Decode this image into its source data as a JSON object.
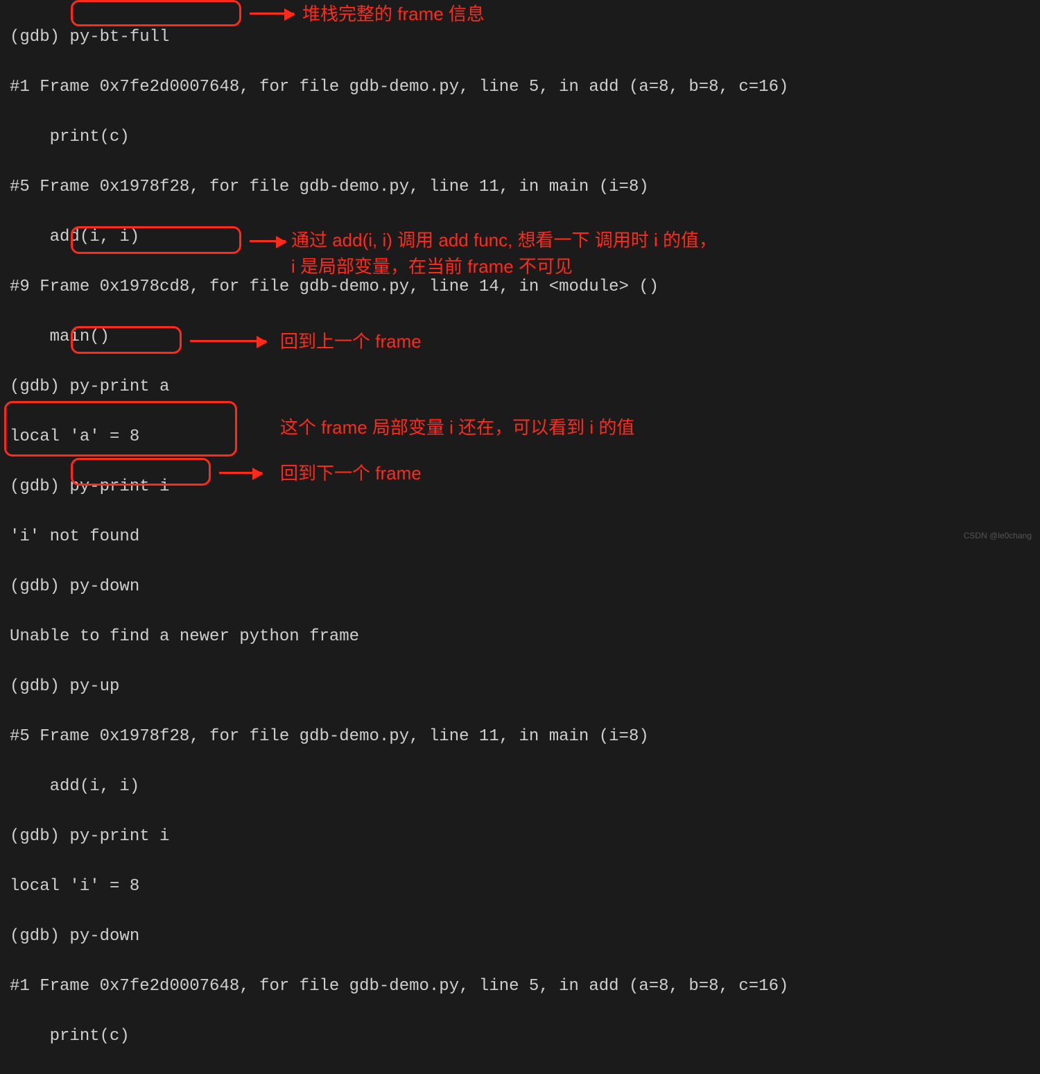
{
  "prompt": "(gdb) ",
  "cmds": {
    "pybtfull": "py-bt-full",
    "pyprint_a": "py-print a",
    "pyprint_i": "py-print i",
    "pydown": "py-down",
    "pyup": "py-up",
    "pyprint_i2": "py-print i",
    "pydown2": "py-down"
  },
  "out": {
    "f1": "#1 Frame 0x7fe2d0007648, for file gdb-demo.py, line 5, in add (a=8, b=8, c=16)",
    "f1b": "    print(c)",
    "f5": "#5 Frame 0x1978f28, for file gdb-demo.py, line 11, in main (i=8)",
    "f5b": "    add(i, i)",
    "f9": "#9 Frame 0x1978cd8, for file gdb-demo.py, line 14, in <module> ()",
    "f9b": "    main()",
    "local_a": "local 'a' = 8",
    "i_notfound": "'i' not found",
    "newer": "Unable to find a newer python frame",
    "f5_2": "#5 Frame 0x1978f28, for file gdb-demo.py, line 11, in main (i=8)",
    "f5_2b": "    add(i, i)",
    "local_i": "local 'i' = 8",
    "f1_2": "#1 Frame 0x7fe2d0007648, for file gdb-demo.py, line 5, in add (a=8, b=8, c=16)",
    "f1_2b": "    print(c)"
  },
  "anno": {
    "a1": "堆栈完整的 frame 信息",
    "a2a": "通过 add(i, i) 调用 add func, 想看一下 调用时 i 的值，",
    "a2b": "i 是局部变量，在当前 frame 不可见",
    "a3": "回到上一个 frame",
    "a4": "这个 frame 局部变量 i 还在，可以看到 i 的值",
    "a5": "回到下一个 frame"
  },
  "watermark": "CSDN @le0chang"
}
